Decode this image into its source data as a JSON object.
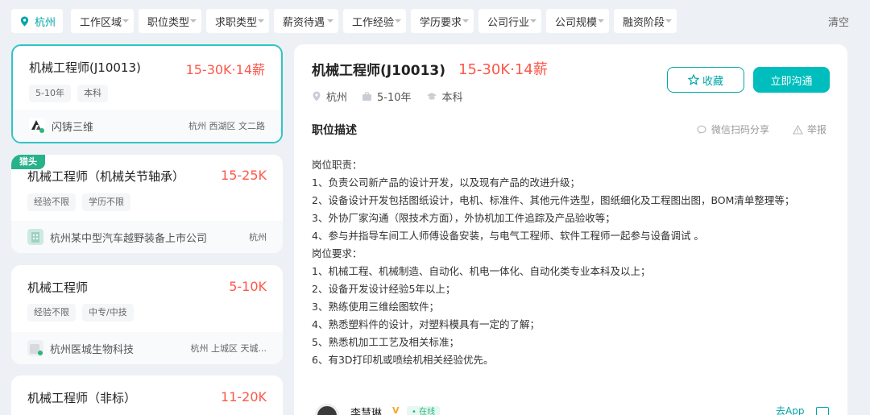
{
  "filters": {
    "city": "杭州",
    "items": [
      "工作区域",
      "职位类型",
      "求职类型",
      "薪资待遇",
      "工作经验",
      "学历要求",
      "公司行业",
      "公司规模",
      "融资阶段"
    ],
    "clear_label": "清空"
  },
  "jobs": [
    {
      "title": "机械工程师(J10013)",
      "salary": "15-30K·14薪",
      "tags": [
        "5-10年",
        "本科"
      ],
      "company": "闪铸三维",
      "location": "杭州  西湖区  文二路",
      "active": true
    },
    {
      "badge": "猎头",
      "title": "机械工程师（机械关节轴承）",
      "salary": "15-25K",
      "tags": [
        "经验不限",
        "学历不限"
      ],
      "company": "杭州某中型汽车越野装备上市公司",
      "location": "杭州"
    },
    {
      "title": "机械工程师",
      "salary": "5-10K",
      "tags": [
        "经验不限",
        "中专/中技"
      ],
      "company": "杭州医城生物科技",
      "location": "杭州  上城区  天城..."
    },
    {
      "title": "机械工程师（非标）",
      "salary": "11-20K"
    }
  ],
  "detail": {
    "title": "机械工程师(J10013)",
    "salary": "15-30K·14薪",
    "meta": {
      "city": "杭州",
      "experience": "5-10年",
      "education": "本科"
    },
    "fav_label": "收藏",
    "chat_label": "立即沟通",
    "section_title": "职位描述",
    "share_label": "微信扫码分享",
    "report_label": "举报",
    "description": [
      "岗位职责：",
      "1、负责公司新产品的设计开发，以及现有产品的改进升级；",
      "2、设备设计开发包括图纸设计，电机、标准件、其他元件选型，图纸细化及工程图出图，BOM清单整理等；",
      "3、外协厂家沟通（限技术方面），外协机加工件追踪及产品验收等；",
      "4、参与并指导车间工人师傅设备安装，与电气工程师、软件工程师一起参与设备调试 。",
      "岗位要求：",
      "1、机械工程、机械制造、自动化、机电一体化、自动化类专业本科及以上；",
      "2、设备开发设计经验5年以上；",
      "3、熟练使用三维绘图软件；",
      "4、熟悉塑料件的设计，对塑料模具有一定的了解；",
      "5、熟悉机加工工艺及相关标准；",
      "6、有3D打印机或喷绘机相关经验优先。"
    ],
    "recruiter": {
      "name": "李慧琳",
      "v_badge": "V",
      "online": "• 在线",
      "app_label": "去App"
    }
  },
  "colors": {
    "accent": "#00bebd",
    "salary": "#fe574a",
    "hunter_badge": "#28b28a"
  }
}
